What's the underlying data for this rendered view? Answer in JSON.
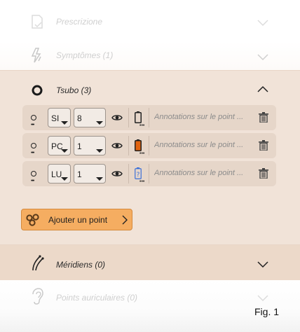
{
  "sections": {
    "prescrizione": {
      "label": "Prescrizione"
    },
    "symptomes": {
      "label": "Symptômes (1)"
    },
    "tsubo": {
      "label": "Tsubo (3)"
    },
    "meridiens": {
      "label": "Méridiens (0)"
    },
    "auriculaires": {
      "label": "Points auriculaires (0)"
    }
  },
  "points": [
    {
      "meridian": "SI",
      "number": "8",
      "annotation_placeholder": "Annotations sur le point ...",
      "battery": "empty"
    },
    {
      "meridian": "PC",
      "number": "1",
      "annotation_placeholder": "Annotations sur le point ...",
      "battery": "full"
    },
    {
      "meridian": "LU",
      "number": "1",
      "annotation_placeholder": "Annotations sur le point ...",
      "battery": "unknown"
    }
  ],
  "add_point": {
    "label": "Ajouter un point"
  },
  "figure": {
    "label": "Fig. 1"
  },
  "colors": {
    "accent": "#f5ad61",
    "panel": "#f1e3d8",
    "battery_full": "#e0620e",
    "battery_unknown": "#3a6fd8"
  }
}
